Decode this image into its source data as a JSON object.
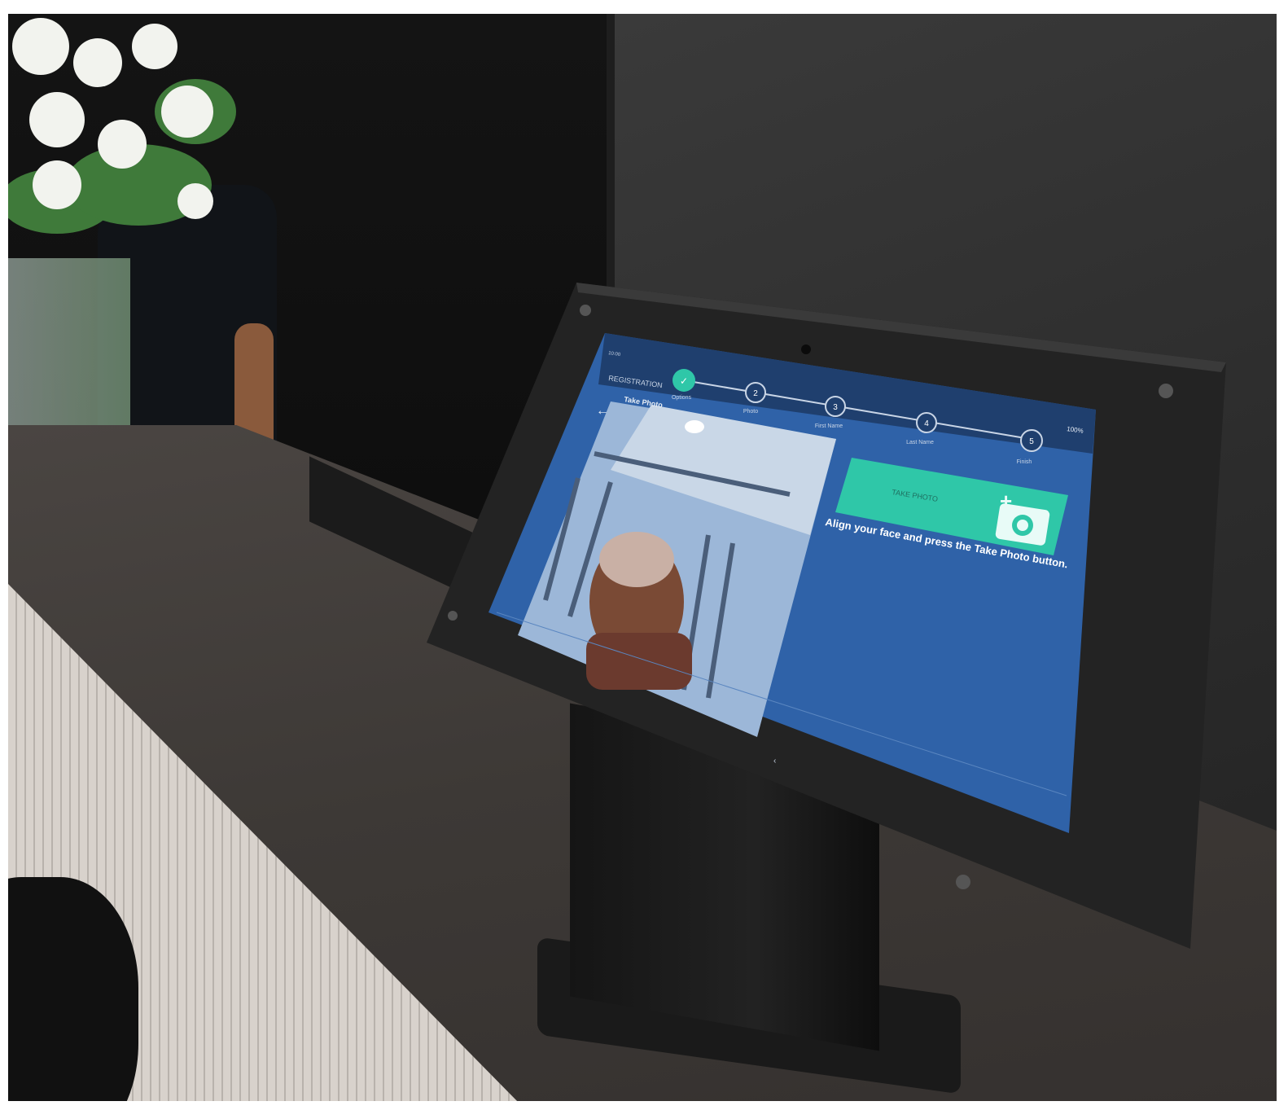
{
  "screen": {
    "status_time": "10:00",
    "status_right": "100%",
    "header_title": "REGISTRATION",
    "step_title": "Take Photo",
    "steps": [
      {
        "number": "✓",
        "label": "Options"
      },
      {
        "number": "2",
        "label": "Photo"
      },
      {
        "number": "3",
        "label": "First Name"
      },
      {
        "number": "4",
        "label": "Last Name"
      },
      {
        "number": "5",
        "label": "Finish"
      }
    ],
    "take_photo_label": "TAKE PHOTO",
    "instruction": "Align your face and press the Take Photo button."
  },
  "colors": {
    "screen_bg": "#2f62a8",
    "header_bg": "#1f3f6e",
    "accent": "#2fc7a8",
    "camera_panel": "#9cb7d8"
  },
  "icons": {
    "back": "back-arrow-icon",
    "camera": "add-camera-icon",
    "step_check": "check-icon"
  }
}
